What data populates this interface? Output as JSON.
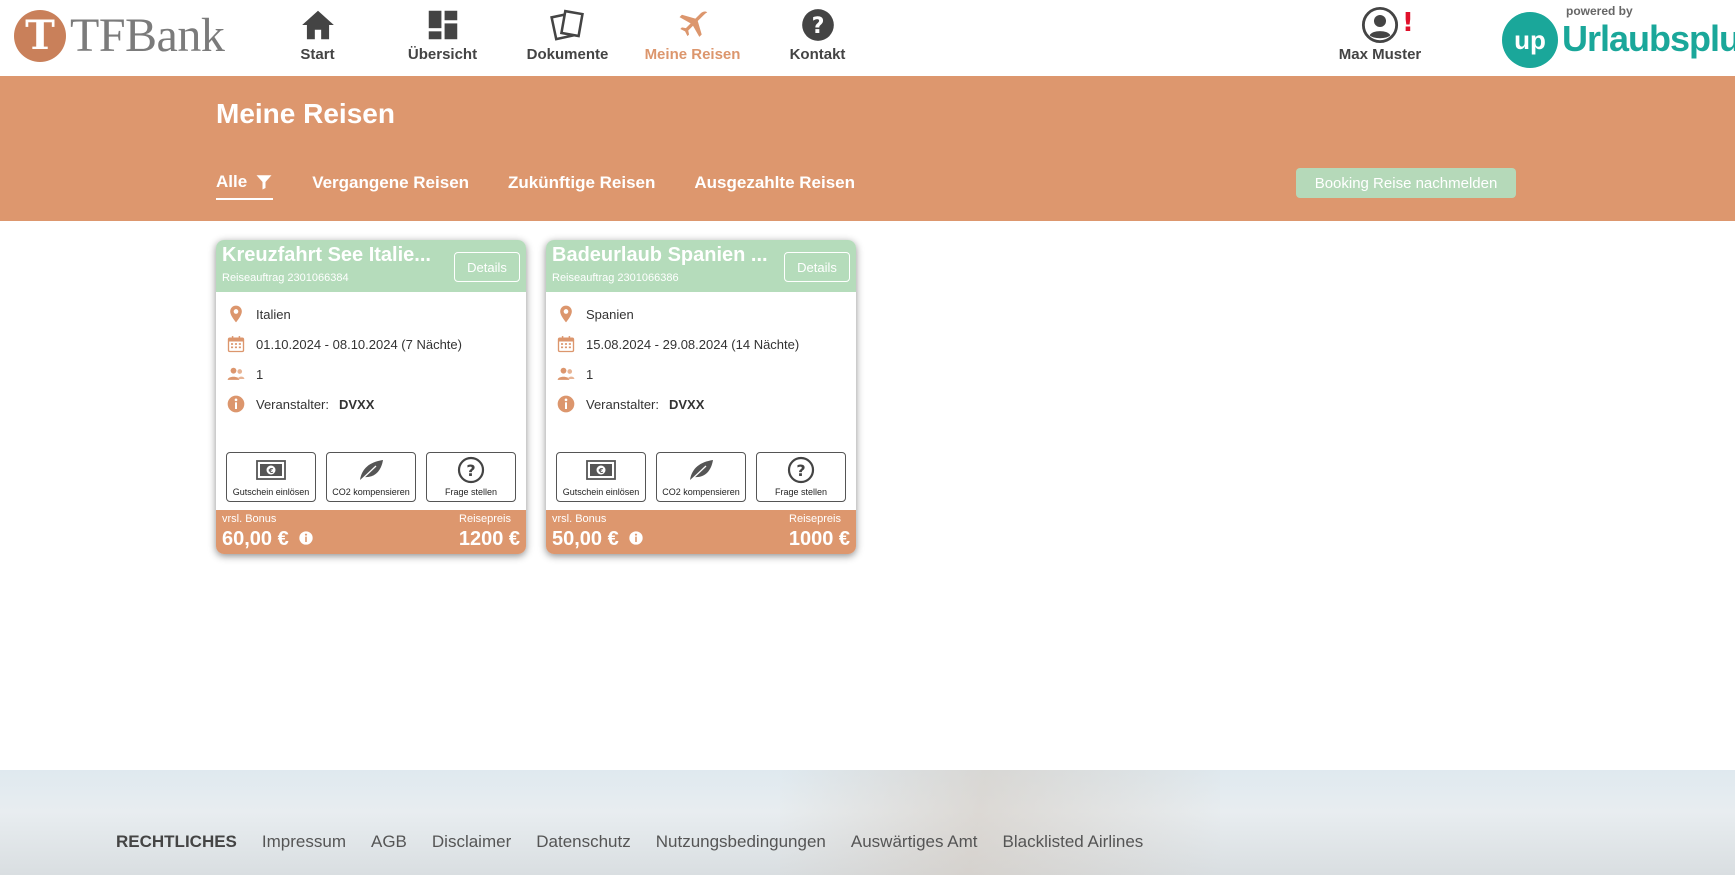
{
  "header": {
    "logo_text": "TFBank",
    "logo_letter": "T",
    "nav": [
      {
        "label": "Start",
        "icon": "home-icon"
      },
      {
        "label": "Übersicht",
        "icon": "dashboard-icon"
      },
      {
        "label": "Dokumente",
        "icon": "documents-icon"
      },
      {
        "label": "Meine Reisen",
        "icon": "airplane-icon",
        "active": true
      },
      {
        "label": "Kontakt",
        "icon": "help-icon"
      }
    ],
    "user_name": "Max Muster",
    "user_alert": "!",
    "powered_by": "powered by",
    "partner_badge": "up",
    "partner_name": "Urlaubsplus"
  },
  "band": {
    "title": "Meine Reisen",
    "tabs": [
      "Alle",
      "Vergangene Reisen",
      "Zukünftige Reisen",
      "Ausgezahlte Reisen"
    ],
    "report_button": "Booking Reise nachmelden"
  },
  "cards": [
    {
      "title": "Kreuzfahrt See Italie...",
      "order": "Reiseauftrag 2301066384",
      "details": "Details",
      "country": "Italien",
      "dates": "01.10.2024 - 08.10.2024 (7 Nächte)",
      "travellers": "1",
      "organizer_label": "Veranstalter:",
      "organizer": "DVXX",
      "actions": [
        "Gutschein einlösen",
        "CO2 kompensieren",
        "Frage stellen"
      ],
      "bonus_label": "vrsl. Bonus",
      "bonus": "60,00 €",
      "price_label": "Reisepreis",
      "price": "1200 €"
    },
    {
      "title": "Badeurlaub Spanien ...",
      "order": "Reiseauftrag 2301066386",
      "details": "Details",
      "country": "Spanien",
      "dates": "15.08.2024 - 29.08.2024 (14 Nächte)",
      "travellers": "1",
      "organizer_label": "Veranstalter:",
      "organizer": "DVXX",
      "actions": [
        "Gutschein einlösen",
        "CO2 kompensieren",
        "Frage stellen"
      ],
      "bonus_label": "vrsl. Bonus",
      "bonus": "50,00 €",
      "price_label": "Reisepreis",
      "price": "1000 €"
    }
  ],
  "footer": {
    "heading": "RECHTLICHES",
    "links": [
      "Impressum",
      "AGB",
      "Disclaimer",
      "Datenschutz",
      "Nutzungsbedingungen",
      "Auswärtiges Amt",
      "Blacklisted Airlines"
    ]
  },
  "colors": {
    "accent": "#dd976e",
    "card_header": "#b5dcbb",
    "partner": "#1aa79a",
    "alert": "#e0102a"
  }
}
